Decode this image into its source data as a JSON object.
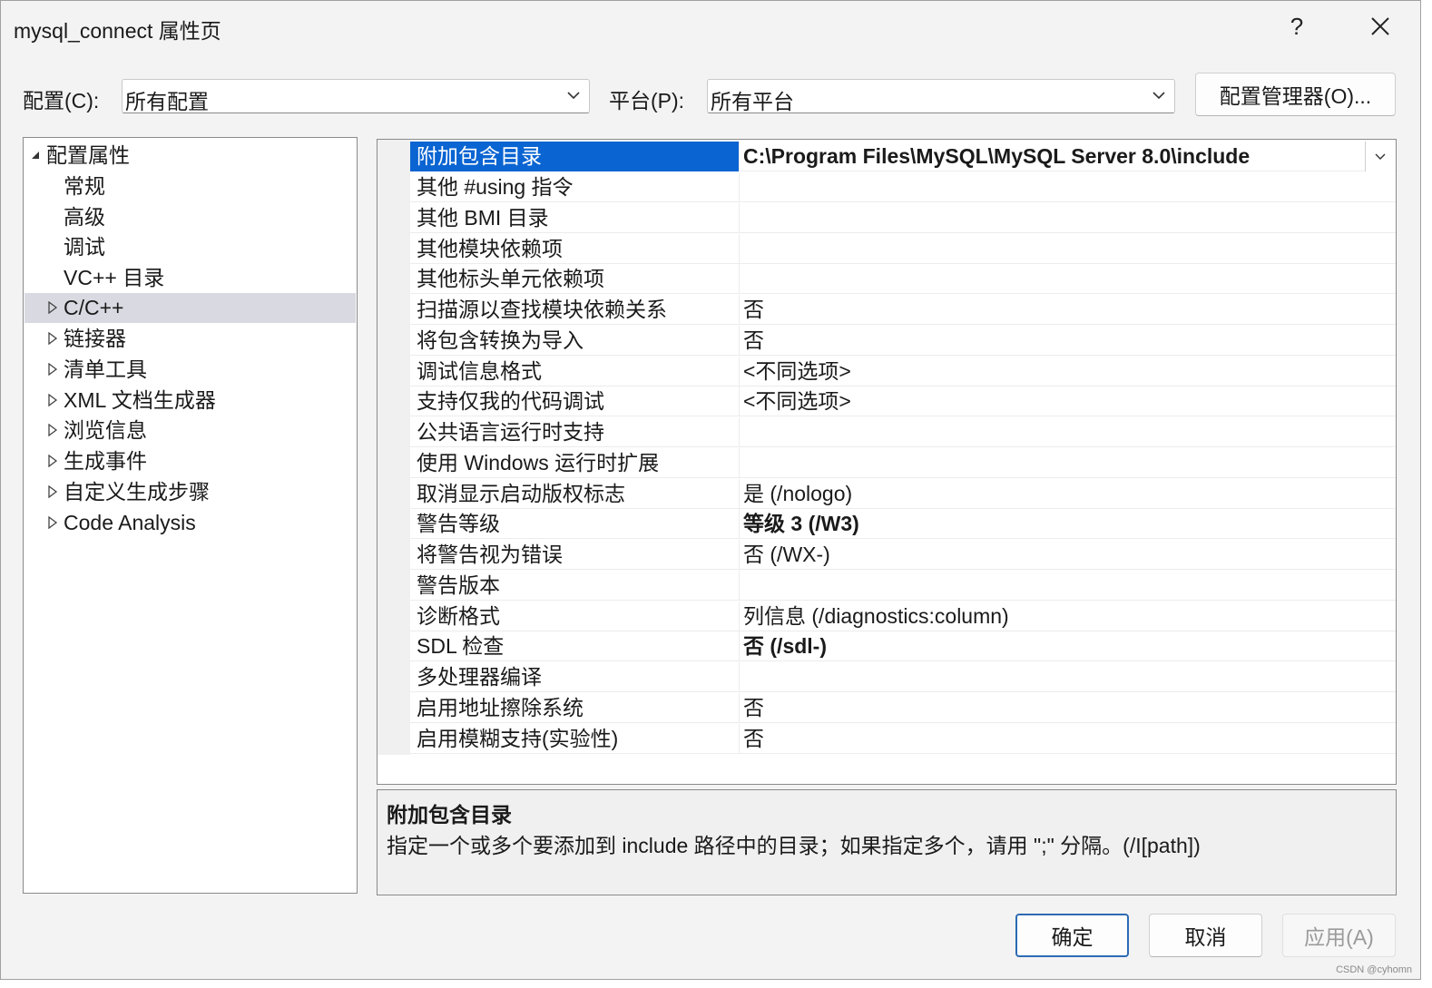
{
  "window": {
    "title": "mysql_connect 属性页",
    "help_label": "?",
    "close_label": "✕"
  },
  "config": {
    "config_label": "配置(C):",
    "config_value": "所有配置",
    "platform_label": "平台(P):",
    "platform_value": "所有平台",
    "manager_button": "配置管理器(O)..."
  },
  "tree": {
    "items": [
      {
        "label": "配置属性",
        "expander": "expanded"
      },
      {
        "label": "常规",
        "expander": "none"
      },
      {
        "label": "高级",
        "expander": "none"
      },
      {
        "label": "调试",
        "expander": "none"
      },
      {
        "label": "VC++ 目录",
        "expander": "none"
      },
      {
        "label": "C/C++",
        "expander": "collapsed",
        "selected": true
      },
      {
        "label": "链接器",
        "expander": "collapsed"
      },
      {
        "label": "清单工具",
        "expander": "collapsed"
      },
      {
        "label": "XML 文档生成器",
        "expander": "collapsed"
      },
      {
        "label": "浏览信息",
        "expander": "collapsed"
      },
      {
        "label": "生成事件",
        "expander": "collapsed"
      },
      {
        "label": "自定义生成步骤",
        "expander": "collapsed"
      },
      {
        "label": "Code Analysis",
        "expander": "collapsed"
      }
    ]
  },
  "properties": {
    "rows": [
      {
        "name": "附加包含目录",
        "value": "C:\\Program Files\\MySQL\\MySQL Server 8.0\\include",
        "bold": true,
        "selected": true
      },
      {
        "name": "其他 #using 指令",
        "value": "",
        "bold": false
      },
      {
        "name": "其他 BMI 目录",
        "value": "",
        "bold": false
      },
      {
        "name": "其他模块依赖项",
        "value": "",
        "bold": false
      },
      {
        "name": "其他标头单元依赖项",
        "value": "",
        "bold": false
      },
      {
        "name": "扫描源以查找模块依赖关系",
        "value": "否",
        "bold": false
      },
      {
        "name": "将包含转换为导入",
        "value": "否",
        "bold": false
      },
      {
        "name": "调试信息格式",
        "value": "<不同选项>",
        "bold": false
      },
      {
        "name": "支持仅我的代码调试",
        "value": "<不同选项>",
        "bold": false
      },
      {
        "name": "公共语言运行时支持",
        "value": "",
        "bold": false
      },
      {
        "name": "使用 Windows 运行时扩展",
        "value": "",
        "bold": false
      },
      {
        "name": "取消显示启动版权标志",
        "value": "是 (/nologo)",
        "bold": false
      },
      {
        "name": "警告等级",
        "value": "等级 3 (/W3)",
        "bold": true
      },
      {
        "name": "将警告视为错误",
        "value": "否 (/WX-)",
        "bold": false
      },
      {
        "name": "警告版本",
        "value": "",
        "bold": false
      },
      {
        "name": "诊断格式",
        "value": "列信息 (/diagnostics:column)",
        "bold": false
      },
      {
        "name": "SDL 检查",
        "value": "否 (/sdl-)",
        "bold": true
      },
      {
        "name": "多处理器编译",
        "value": "",
        "bold": false
      },
      {
        "name": "启用地址擦除系统",
        "value": "否",
        "bold": false
      },
      {
        "name": "启用模糊支持(实验性)",
        "value": "否",
        "bold": false
      }
    ]
  },
  "description": {
    "title": "附加包含目录",
    "text": "指定一个或多个要添加到 include 路径中的目录；如果指定多个，请用 \";\" 分隔。(/I[path])"
  },
  "buttons": {
    "ok": "确定",
    "cancel": "取消",
    "apply": "应用(A)"
  },
  "watermark": "CSDN @cyhomn",
  "colors": {
    "selection": "#0a64d2",
    "tree_selection": "#d9d9e2",
    "primary_border": "#2c6bb4"
  }
}
